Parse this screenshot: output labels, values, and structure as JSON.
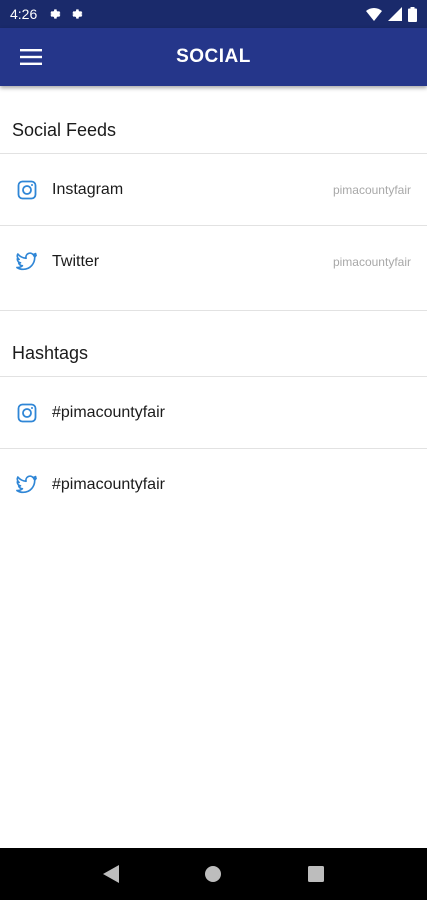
{
  "status_bar": {
    "time": "4:26"
  },
  "app_bar": {
    "title": "SOCIAL",
    "menu_icon": "hamburger-menu-icon"
  },
  "colors": {
    "status_bar": "#1a2a6b",
    "app_bar": "#25368a",
    "icon_blue": "#2f86d6"
  },
  "social_feeds": {
    "header": "Social Feeds",
    "items": [
      {
        "icon": "instagram-icon",
        "label": "Instagram",
        "handle": "pimacountyfair"
      },
      {
        "icon": "twitter-icon",
        "label": "Twitter",
        "handle": "pimacountyfair"
      }
    ]
  },
  "hashtags": {
    "header": "Hashtags",
    "items": [
      {
        "icon": "instagram-icon",
        "label": "#pimacountyfair"
      },
      {
        "icon": "twitter-icon",
        "label": "#pimacountyfair"
      }
    ]
  },
  "nav_bar": {
    "back": "back-icon",
    "home": "home-icon",
    "recents": "recents-icon"
  }
}
